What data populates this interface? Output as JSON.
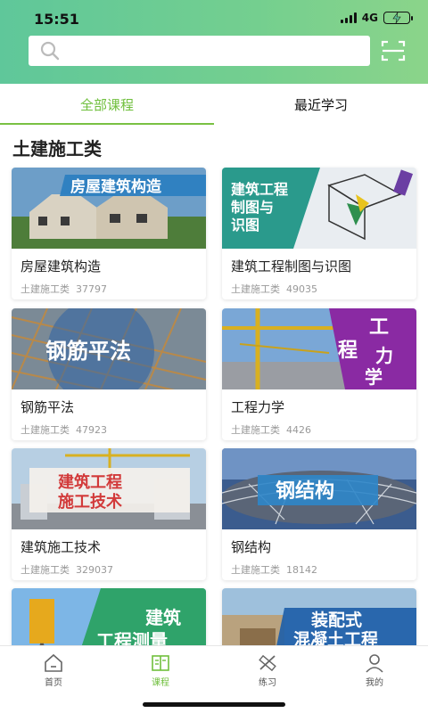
{
  "status": {
    "time": "15:51",
    "network": "4G"
  },
  "search": {
    "placeholder": ""
  },
  "tabs": [
    {
      "label": "全部课程",
      "active": true
    },
    {
      "label": "最近学习",
      "active": false
    }
  ],
  "section_title": "土建施工类",
  "courses": [
    {
      "name": "房屋建筑构造",
      "category": "土建施工类",
      "count": "37797",
      "thumb_text": "房屋建筑构造"
    },
    {
      "name": "建筑工程制图与识图",
      "category": "土建施工类",
      "count": "49035",
      "thumb_text": "建筑工程 制图与 识图"
    },
    {
      "name": "钢筋平法",
      "category": "土建施工类",
      "count": "47923",
      "thumb_text": "钢筋平法"
    },
    {
      "name": "工程力学",
      "category": "土建施工类",
      "count": "4426",
      "thumb_text": "工 程 力 学"
    },
    {
      "name": "建筑施工技术",
      "category": "土建施工类",
      "count": "329037",
      "thumb_text": "建筑工程 施工技术"
    },
    {
      "name": "钢结构",
      "category": "土建施工类",
      "count": "18142",
      "thumb_text": "钢结构"
    },
    {
      "name": "",
      "category": "",
      "count": "",
      "thumb_text": "建筑 工程测量"
    },
    {
      "name": "",
      "category": "",
      "count": "",
      "thumb_text": "装配式 混凝土工程"
    }
  ],
  "bottom_nav": [
    {
      "label": "首页",
      "icon": "home-icon",
      "active": false
    },
    {
      "label": "课程",
      "icon": "book-icon",
      "active": true
    },
    {
      "label": "练习",
      "icon": "pencil-ruler-icon",
      "active": false
    },
    {
      "label": "我的",
      "icon": "user-icon",
      "active": false
    }
  ],
  "colors": {
    "accent": "#6fbf3c",
    "header_start": "#5fc79a",
    "header_end": "#8bd48a"
  }
}
